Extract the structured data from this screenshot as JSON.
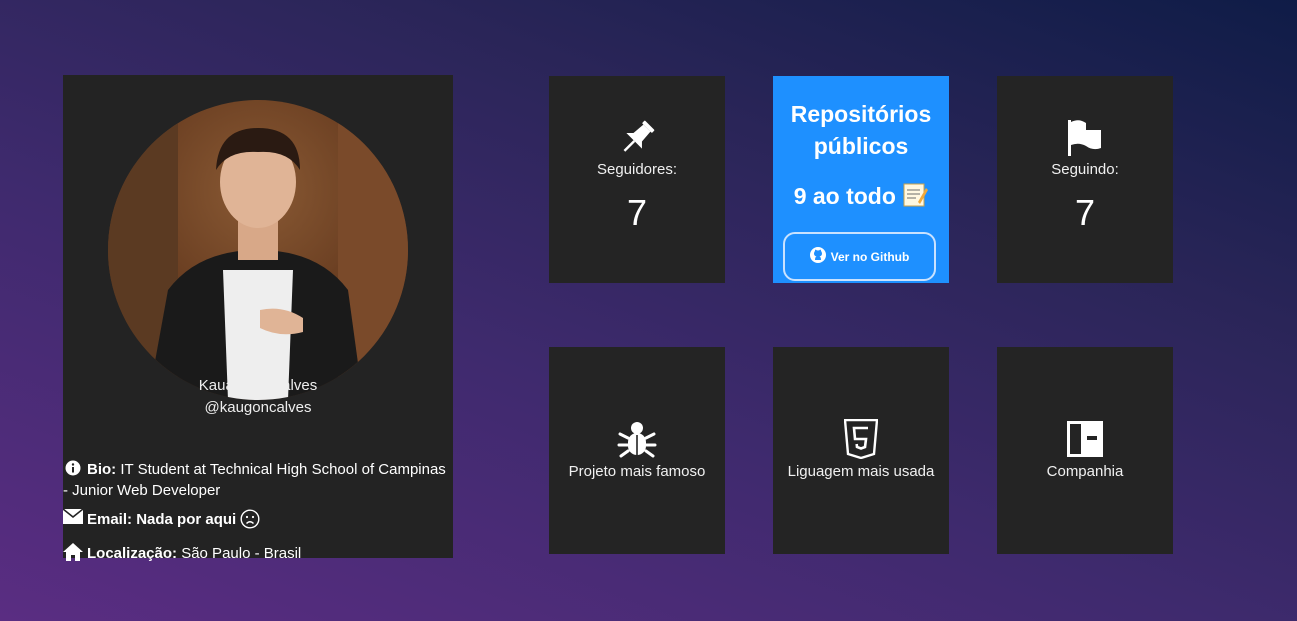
{
  "profile": {
    "name": "Kauan Gonçalves",
    "handle": "@kaugoncalves",
    "bio_label": "Bio:",
    "bio_text": "IT Student at Technical High School of Campinas - Junior Web Developer",
    "email_label": "Email:",
    "email_text": "Nada por aqui",
    "location_label": "Localização:",
    "location_text": "São Paulo - Brasil"
  },
  "cards": {
    "followers_label": "Seguidores:",
    "followers_count": "7",
    "repos_title": "Repositórios públicos",
    "repos_count": "9 ao todo",
    "repos_button": "Ver no Github",
    "following_label": "Seguindo:",
    "following_count": "7",
    "famous_project_label": "Projeto mais famoso",
    "language_label": "Liguagem mais usada",
    "company_label": "Companhia"
  },
  "icons": {
    "followers": "pin-icon",
    "following": "flag-icon",
    "famous_project": "bug-icon",
    "language": "html5-icon",
    "company": "building-icon",
    "github": "github-icon",
    "bio": "info-icon",
    "email": "envelope-icon",
    "location": "home-icon"
  },
  "colors": {
    "card_bg": "#242424",
    "accent_blue": "#1e90ff"
  }
}
